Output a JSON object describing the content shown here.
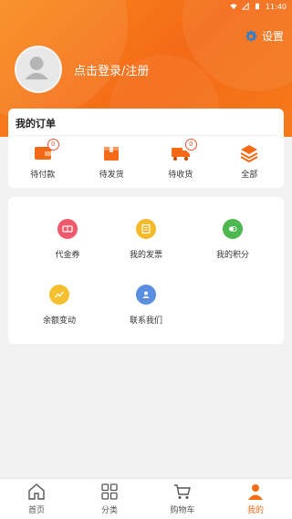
{
  "status": {
    "time": "11:40"
  },
  "header": {
    "settings_label": "设置",
    "login_text": "点击登录/注册"
  },
  "orders": {
    "title": "我的订单",
    "items": [
      {
        "label": "待付款",
        "icon": "wallet-icon",
        "badge": "0"
      },
      {
        "label": "待发货",
        "icon": "box-icon",
        "badge": ""
      },
      {
        "label": "待收货",
        "icon": "truck-icon",
        "badge": "0"
      },
      {
        "label": "全部",
        "icon": "layers-icon",
        "badge": ""
      }
    ]
  },
  "services": [
    {
      "label": "代金券",
      "icon": "voucher-icon",
      "color": "#f0596b"
    },
    {
      "label": "我的发票",
      "icon": "invoice-icon",
      "color": "#f5b92c"
    },
    {
      "label": "我的积分",
      "icon": "points-icon",
      "color": "#4cb84f"
    },
    {
      "label": "余额变动",
      "icon": "balance-icon",
      "color": "#f5c02f"
    },
    {
      "label": "联系我们",
      "icon": "contact-icon",
      "color": "#5a8fe0"
    }
  ],
  "tabbar": [
    {
      "label": "首页",
      "icon": "home-icon"
    },
    {
      "label": "分类",
      "icon": "grid-icon"
    },
    {
      "label": "购物车",
      "icon": "cart-icon"
    },
    {
      "label": "我的",
      "icon": "user-icon"
    }
  ],
  "colors": {
    "accent": "#f46a17",
    "badge": "#ee5533"
  }
}
